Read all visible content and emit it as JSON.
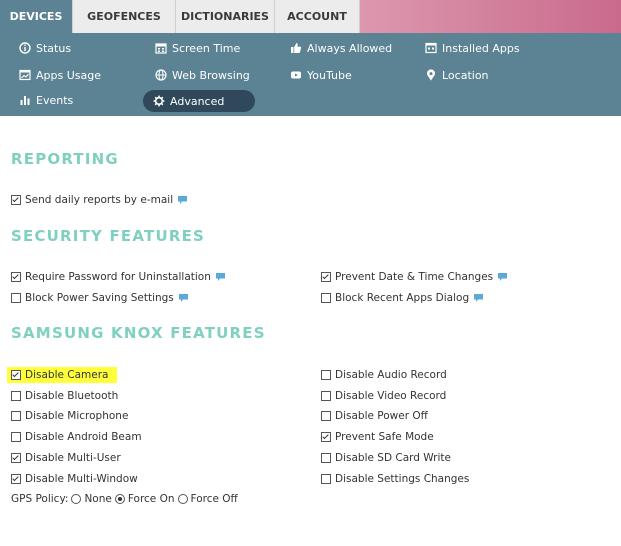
{
  "tabs": [
    {
      "label": "DEVICES",
      "active": true
    },
    {
      "label": "GEOFENCES",
      "active": false
    },
    {
      "label": "DICTIONARIES",
      "active": false
    },
    {
      "label": "ACCOUNT",
      "active": false
    }
  ],
  "subnav": [
    {
      "label": "Status",
      "icon": "info-icon"
    },
    {
      "label": "Screen Time",
      "icon": "calendar-icon"
    },
    {
      "label": "Always Allowed",
      "icon": "thumbs-up-icon"
    },
    {
      "label": "Installed Apps",
      "icon": "apps-window-icon"
    },
    {
      "label": "Apps Usage",
      "icon": "chart-window-icon"
    },
    {
      "label": "Web Browsing",
      "icon": "globe-icon"
    },
    {
      "label": "YouTube",
      "icon": "youtube-icon"
    },
    {
      "label": "Location",
      "icon": "map-pin-icon"
    },
    {
      "label": "Events",
      "icon": "bar-chart-icon"
    },
    {
      "label": "Advanced",
      "icon": "gear-icon",
      "active": true
    }
  ],
  "sections": {
    "reporting": "REPORTING",
    "security": "SECURITY FEATURES",
    "knox": "SAMSUNG KNOX FEATURES"
  },
  "reporting": {
    "daily_reports": {
      "label": "Send daily reports by e-mail",
      "checked": true
    }
  },
  "security": {
    "require_password": {
      "label": "Require Password for Uninstallation",
      "checked": true
    },
    "prevent_date_time": {
      "label": "Prevent Date & Time Changes",
      "checked": true
    },
    "block_power_saving": {
      "label": "Block Power Saving Settings",
      "checked": false
    },
    "block_recent_apps": {
      "label": "Block Recent Apps Dialog",
      "checked": false
    }
  },
  "knox": {
    "disable_camera": {
      "label": "Disable Camera",
      "checked": true
    },
    "disable_audio_record": {
      "label": "Disable Audio Record",
      "checked": false
    },
    "disable_bluetooth": {
      "label": "Disable Bluetooth",
      "checked": false
    },
    "disable_video_record": {
      "label": "Disable Video Record",
      "checked": false
    },
    "disable_microphone": {
      "label": "Disable Microphone",
      "checked": false
    },
    "disable_power_off": {
      "label": "Disable Power Off",
      "checked": false
    },
    "disable_android_beam": {
      "label": "Disable Android Beam",
      "checked": false
    },
    "prevent_safe_mode": {
      "label": "Prevent Safe Mode",
      "checked": true
    },
    "disable_multi_user": {
      "label": "Disable Multi-User",
      "checked": true
    },
    "disable_sd_card_write": {
      "label": "Disable SD Card Write",
      "checked": false
    },
    "disable_multi_window": {
      "label": "Disable Multi-Window",
      "checked": true
    },
    "disable_settings_changes": {
      "label": "Disable Settings Changes",
      "checked": false
    }
  },
  "gps_policy": {
    "label": "GPS Policy:",
    "options": [
      "None",
      "Force On",
      "Force Off"
    ],
    "selected": "Force On"
  },
  "colors": {
    "accent": "#5b8393",
    "active_pill": "#30495a",
    "section_title": "#7fd0c0",
    "highlight": "#ffff3a",
    "help_icon": "#5aa9d6"
  }
}
